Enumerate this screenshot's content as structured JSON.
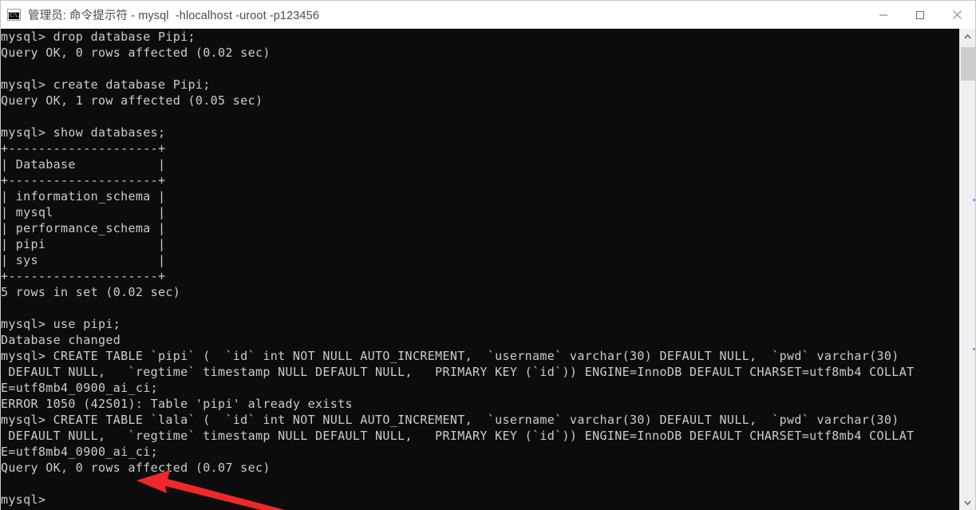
{
  "window": {
    "title": "管理员: 命令提示符 - mysql  -hlocalhost -uroot -p123456",
    "icon_name": "cmd-console-icon",
    "icon_text": "C:\\.",
    "background_color": "#0c0c0c",
    "titlebar_color": "#ffffff",
    "text_color": "#ccccd0",
    "controls": {
      "minimize_label": "Minimize",
      "maximize_label": "Maximize",
      "close_label": "Close"
    }
  },
  "terminal": {
    "prompt": "mysql>",
    "lines": [
      "mysql> drop database Pipi;",
      "Query OK, 0 rows affected (0.02 sec)",
      "",
      "mysql> create database Pipi;",
      "Query OK, 1 row affected (0.05 sec)",
      "",
      "mysql> show databases;",
      "+--------------------+",
      "| Database           |",
      "+--------------------+",
      "| information_schema |",
      "| mysql              |",
      "| performance_schema |",
      "| pipi               |",
      "| sys                |",
      "+--------------------+",
      "5 rows in set (0.02 sec)",
      "",
      "mysql> use pipi;",
      "Database changed",
      "mysql> CREATE TABLE `pipi` (  `id` int NOT NULL AUTO_INCREMENT,  `username` varchar(30) DEFAULT NULL,  `pwd` varchar(30)",
      " DEFAULT NULL,   `regtime` timestamp NULL DEFAULT NULL,   PRIMARY KEY (`id`)) ENGINE=InnoDB DEFAULT CHARSET=utf8mb4 COLLAT",
      "E=utf8mb4_0900_ai_ci;",
      "ERROR 1050 (42S01): Table 'pipi' already exists",
      "mysql> CREATE TABLE `lala` (  `id` int NOT NULL AUTO_INCREMENT,  `username` varchar(30) DEFAULT NULL,  `pwd` varchar(30)",
      " DEFAULT NULL,   `regtime` timestamp NULL DEFAULT NULL,   PRIMARY KEY (`id`)) ENGINE=InnoDB DEFAULT CHARSET=utf8mb4 COLLAT",
      "E=utf8mb4_0900_ai_ci;",
      "Query OK, 0 rows affected (0.07 sec)",
      "",
      "mysql>"
    ]
  },
  "scrollbar": {
    "up_arrow_name": "scroll-up-arrow",
    "down_arrow_name": "scroll-down-arrow",
    "thumb_name": "scrollbar-thumb"
  },
  "annotation": {
    "arrow_color": "#f02828",
    "description": "red arrow pointing at Query OK, 0 rows affected (0.07 sec)"
  }
}
